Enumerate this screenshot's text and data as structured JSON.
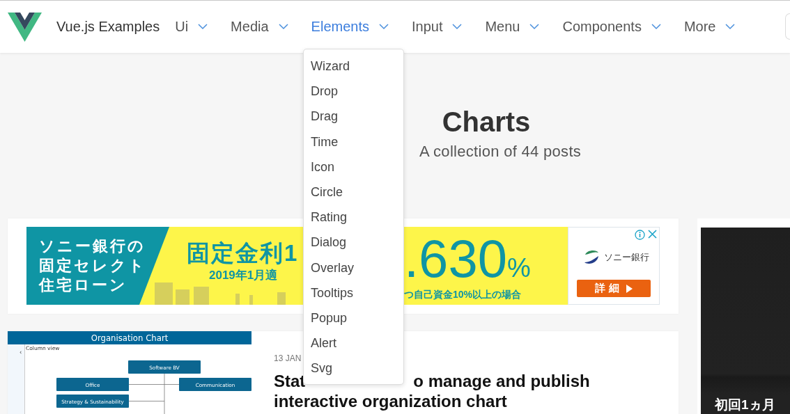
{
  "nav": {
    "brand": "Vue.js Examples",
    "items": [
      {
        "label": "Ui",
        "selected": false
      },
      {
        "label": "Media",
        "selected": false
      },
      {
        "label": "Elements",
        "selected": true
      },
      {
        "label": "Input",
        "selected": false
      },
      {
        "label": "Menu",
        "selected": false
      },
      {
        "label": "Components",
        "selected": false
      },
      {
        "label": "More",
        "selected": false
      }
    ]
  },
  "dropdown": {
    "items": [
      "Wizard",
      "Drop",
      "Drag",
      "Time",
      "Icon",
      "Circle",
      "Rating",
      "Dialog",
      "Overlay",
      "Tooltips",
      "Popup",
      "Alert",
      "Svg"
    ]
  },
  "hero": {
    "title": "Charts",
    "subtitle": "A collection of 44 posts"
  },
  "ad": {
    "left_lines": [
      "ソニー銀行の",
      "固定セレクト",
      "住宅ローン"
    ],
    "headline": "固定金利1",
    "date_note": "2019年1月適",
    "rate": ".630",
    "rate_unit": "%",
    "condition": "つ自己資金10%以上の場合",
    "bank": "ソニー銀行",
    "button": "詳 細"
  },
  "post": {
    "image": {
      "title": "Organisation Chart",
      "back": "‹",
      "view_option": "Column view",
      "nodes": [
        "Software BV",
        "Office",
        "Communication",
        "Strategy & Sustainability"
      ]
    },
    "date": "13 JAN",
    "title_parts": [
      "Stat",
      "o manage and publish"
    ],
    "title_line2": "interactive organization chart"
  },
  "side": {
    "text": "初回1ヵ月"
  }
}
